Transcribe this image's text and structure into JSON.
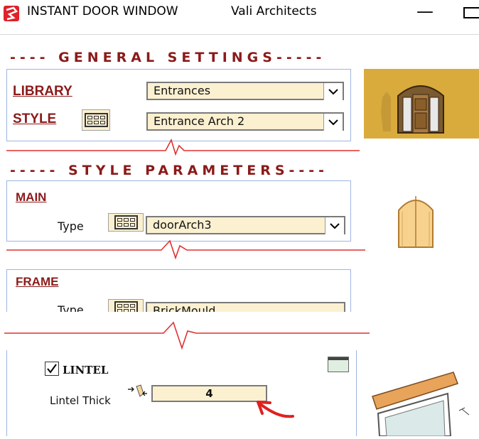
{
  "titlebar": {
    "app_name": "INSTANT DOOR WINDOW",
    "vendor": "Vali Architects",
    "minimize_glyph": "—"
  },
  "general": {
    "heading": "---- GENERAL SETTINGS-----",
    "library_label": "LIBRARY",
    "library_value": "Entrances",
    "style_label": "STYLE",
    "style_value": "Entrance Arch 2"
  },
  "style_params": {
    "heading": "----- STYLE PARAMETERS----"
  },
  "main": {
    "label": "MAIN",
    "type_label": "Type",
    "type_value": "doorArch3"
  },
  "frame": {
    "label": "FRAME",
    "type_label": "Type",
    "type_value": "BrickMould"
  },
  "lintel": {
    "label": "LINTEL",
    "checked": true,
    "thick_label": "Lintel Thick",
    "thick_value": "4"
  },
  "colors": {
    "heading": "#8b1a1a",
    "panel_border": "#9db6e0",
    "combo_bg": "#fbf0d0",
    "separator": "#e03030"
  }
}
